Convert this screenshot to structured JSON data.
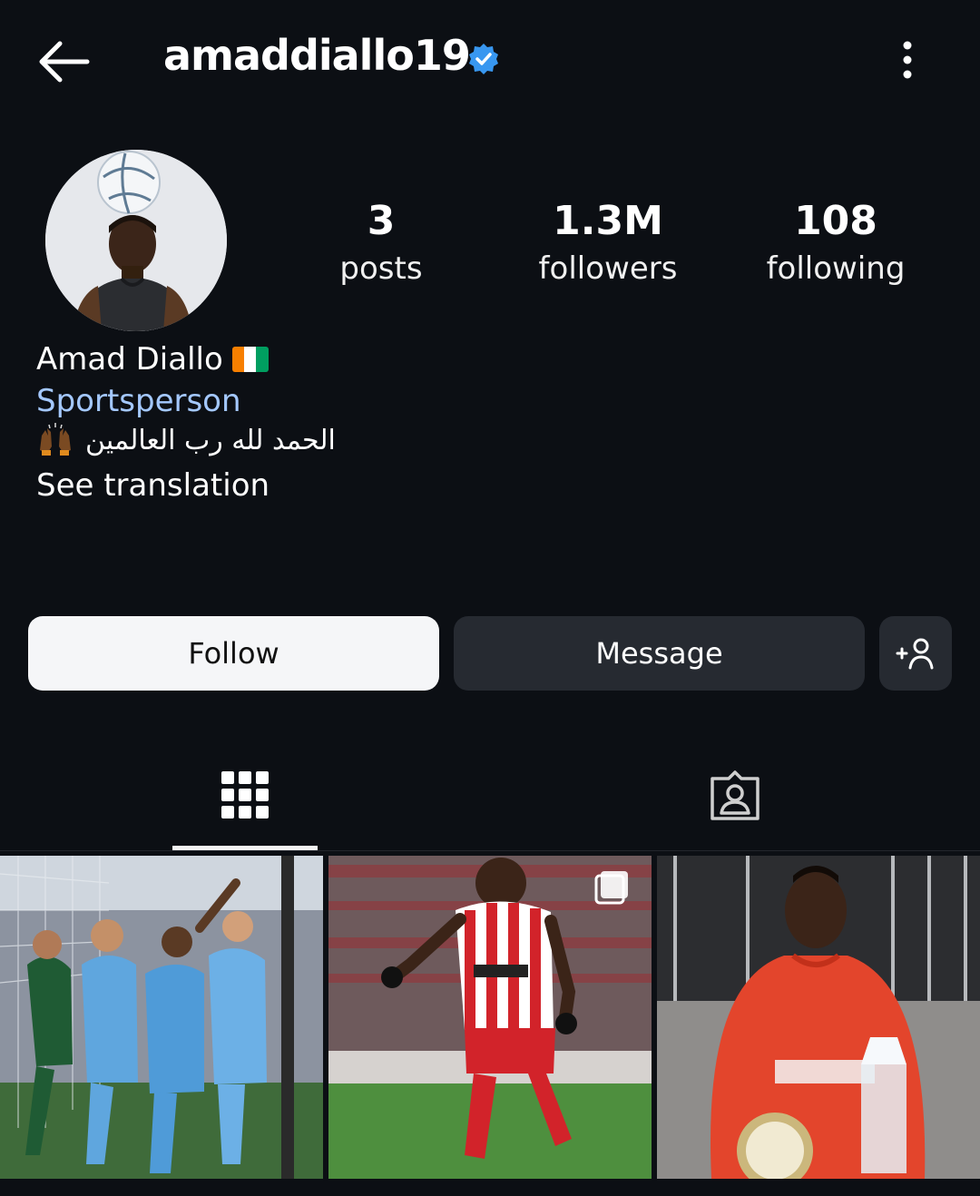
{
  "header": {
    "username": "amaddiallo19",
    "verified": true,
    "icons": {
      "back": "arrow-left-icon",
      "more": "vertical-dots-icon",
      "verified": "verified-badge-icon"
    }
  },
  "profile": {
    "stats": [
      {
        "value": "3",
        "label": "posts"
      },
      {
        "value": "1.3M",
        "label": "followers"
      },
      {
        "value": "108",
        "label": "following"
      }
    ],
    "display_name": "Amad Diallo",
    "flag": "Côte d'Ivoire flag",
    "category": "Sportsperson",
    "bio": "الحمد لله رب العالمين",
    "bio_emoji": "raising-hands-emoji",
    "see_translation": "See translation"
  },
  "actions": {
    "follow": "Follow",
    "message": "Message",
    "add_person_icon": "add-person-icon"
  },
  "tabs": [
    {
      "name": "grid",
      "icon": "grid-icon",
      "active": true
    },
    {
      "name": "tagged",
      "icon": "tagged-person-icon",
      "active": false
    }
  ],
  "colors": {
    "background": "#0c0f14",
    "category_link": "#a4c8ff",
    "verified_blue": "#3897f0",
    "follow_button": "#f5f6f8",
    "secondary_button": "#262a31"
  }
}
